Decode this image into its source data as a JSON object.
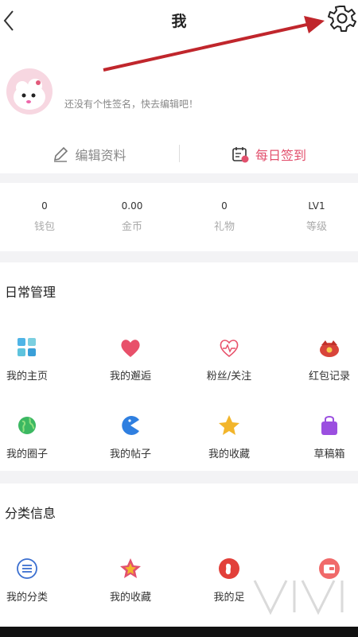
{
  "header": {
    "title": "我"
  },
  "profile": {
    "signature": "还没有个性签名，快去编辑吧！"
  },
  "actions": {
    "edit_label": "编辑资料",
    "checkin_label": "每日签到"
  },
  "stats": [
    {
      "value": "0",
      "label": "钱包"
    },
    {
      "value": "0.00",
      "label": "金币"
    },
    {
      "value": "0",
      "label": "礼物"
    },
    {
      "value": "LV1",
      "label": "等级"
    }
  ],
  "daily": {
    "title": "日常管理",
    "items": [
      {
        "label": "我的主页",
        "icon": "homepage-grid-icon"
      },
      {
        "label": "我的邂逅",
        "icon": "heart-icon"
      },
      {
        "label": "粉丝/关注",
        "icon": "heartbeat-icon"
      },
      {
        "label": "红包记录",
        "icon": "red-envelope-icon"
      },
      {
        "label": "我的圈子",
        "icon": "globe-icon"
      },
      {
        "label": "我的帖子",
        "icon": "pacman-icon"
      },
      {
        "label": "我的收藏",
        "icon": "star-icon"
      },
      {
        "label": "草稿箱",
        "icon": "bag-icon"
      }
    ]
  },
  "category": {
    "title": "分类信息",
    "items": [
      {
        "label": "我的分类",
        "icon": "list-icon"
      },
      {
        "label": "我的收藏",
        "icon": "star-badge-icon"
      },
      {
        "label": "我的足",
        "icon": "footprint-icon"
      },
      {
        "label": "",
        "icon": "wallet-icon"
      }
    ]
  },
  "colors": {
    "accent": "#e2506d",
    "arrow": "#c0262c"
  }
}
